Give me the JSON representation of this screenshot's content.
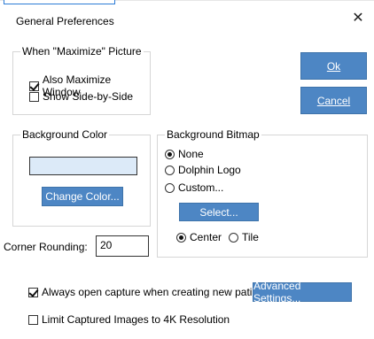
{
  "dialog": {
    "title": "General Preferences"
  },
  "maximize_group": {
    "title": "When \"Maximize\" Picture",
    "also_maximize_window": {
      "label": "Also Maximize Window",
      "checked": true
    },
    "show_side_by_side": {
      "label": "Show Side-by-Side",
      "checked": false
    }
  },
  "buttons": {
    "ok_label": "Ok",
    "cancel_label": "Cancel"
  },
  "background_color": {
    "title": "Background Color",
    "swatch_color": "#dceaf8",
    "change_label": "Change Color..."
  },
  "background_bitmap": {
    "title": "Background Bitmap",
    "options": [
      {
        "label": "None",
        "selected": true
      },
      {
        "label": "Dolphin Logo",
        "selected": false
      },
      {
        "label": "Custom...",
        "selected": false
      }
    ],
    "select_label": "Select...",
    "placement": [
      {
        "label": "Center",
        "selected": true
      },
      {
        "label": "Tile",
        "selected": false
      }
    ]
  },
  "corner_rounding": {
    "label": "Corner Rounding:",
    "value": "20"
  },
  "options": {
    "always_open_capture": {
      "label": "Always open capture when creating new patient",
      "checked": true
    },
    "limit_4k": {
      "label": "Limit Captured Images to 4K Resolution",
      "checked": false
    }
  },
  "advanced_settings_label": "Advanced Settings...",
  "colors": {
    "button_blue": "#4d86c4"
  }
}
